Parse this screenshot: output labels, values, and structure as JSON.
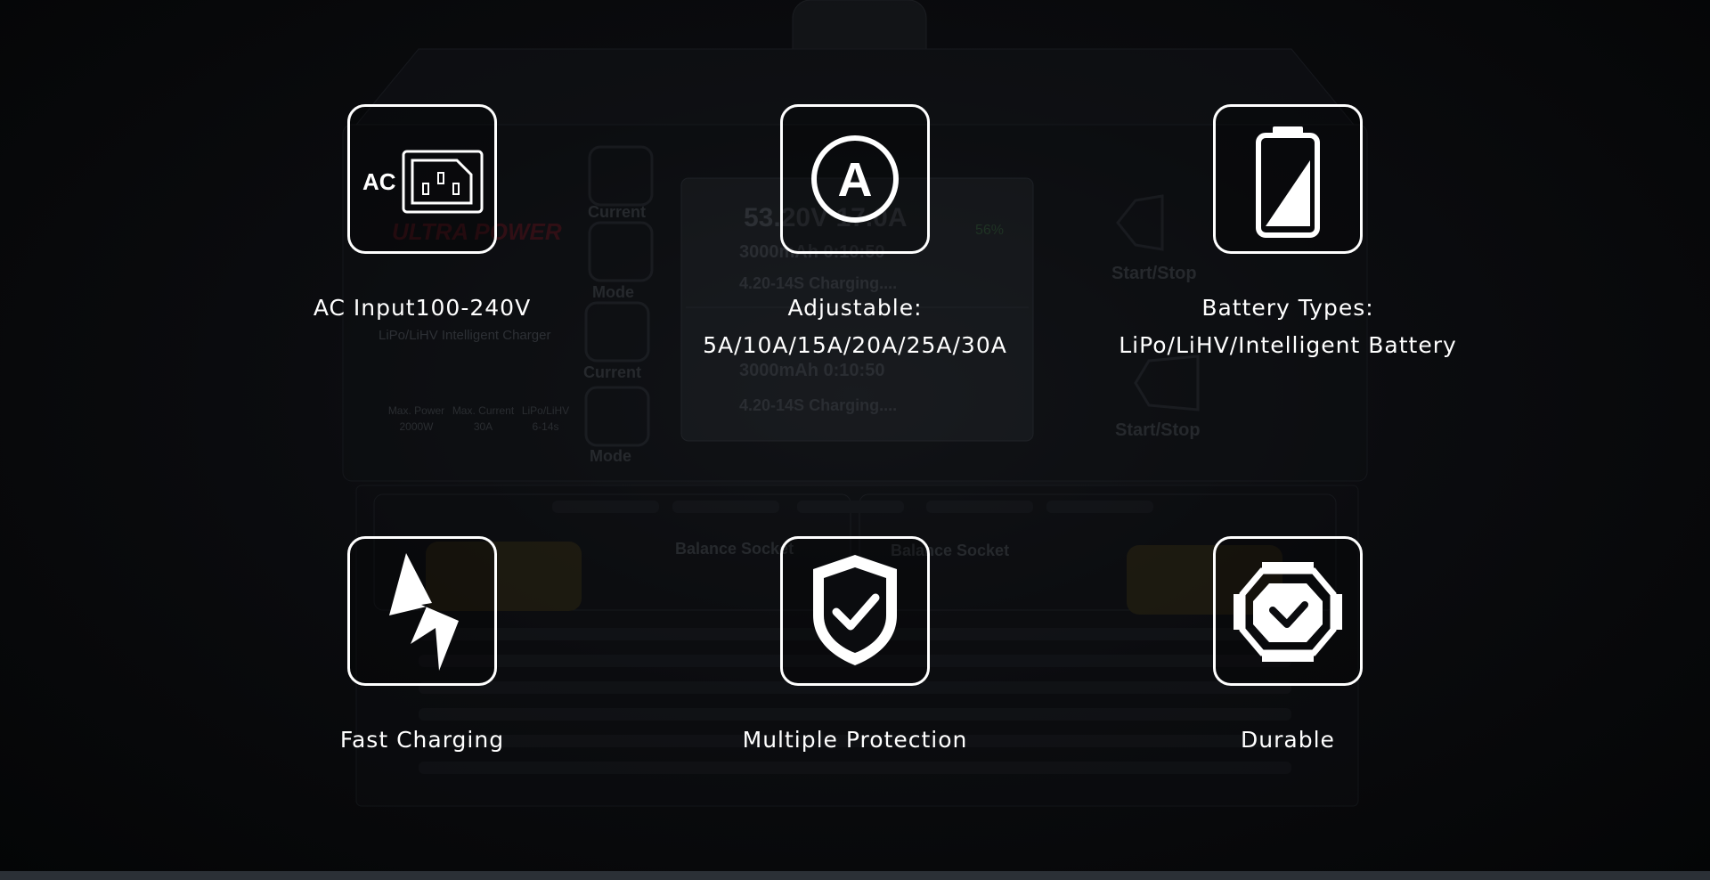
{
  "background": {
    "brand_text": "ULTRA POWER",
    "subtitle": "LiPo/LiHV Intelligent Charger",
    "specs": [
      {
        "label": "Max. Power",
        "value": "2000W"
      },
      {
        "label": "Max. Current",
        "value": "30A"
      },
      {
        "label": "LiPo/LiHV",
        "value": "6-14s"
      }
    ],
    "buttons": [
      "Current",
      "Mode",
      "Current",
      "Mode"
    ],
    "start_stop": [
      "Start/Stop",
      "Start/Stop"
    ],
    "balance_socket": [
      "Balance Socket",
      "Balance Socket"
    ],
    "display": {
      "ch1_voltage": "53.20V",
      "ch1_current": "17.0A",
      "ch1_capacity": "3000mAh",
      "ch1_time": "0:10:50",
      "ch1_cells": "4.20-14S",
      "ch1_status": "Charging....",
      "ch1_percent": "56%",
      "ch2_capacity": "3000mAh",
      "ch2_time": "0:10:50",
      "ch2_cells": "4.20-14S",
      "ch2_status": "Charging...."
    }
  },
  "features": [
    {
      "icon": "ac-plug-icon",
      "icon_label": "AC",
      "line1": "AC Input100-240V",
      "line2": ""
    },
    {
      "icon": "ampere-icon",
      "icon_label": "A",
      "line1": "Adjustable:",
      "line2": "5A/10A/15A/20A/25A/30A"
    },
    {
      "icon": "battery-icon",
      "icon_label": "",
      "line1": "Battery Types:",
      "line2": "LiPo/LiHV/Intelligent Battery"
    },
    {
      "icon": "lightning-icon",
      "icon_label": "",
      "line1": "Fast Charging",
      "line2": ""
    },
    {
      "icon": "shield-check-icon",
      "icon_label": "",
      "line1": "Multiple Protection",
      "line2": ""
    },
    {
      "icon": "durable-frame-icon",
      "icon_label": "",
      "line1": "Durable",
      "line2": ""
    }
  ],
  "colors": {
    "background": "#050608",
    "icon_stroke": "#ffffff",
    "text": "#ffffff"
  }
}
